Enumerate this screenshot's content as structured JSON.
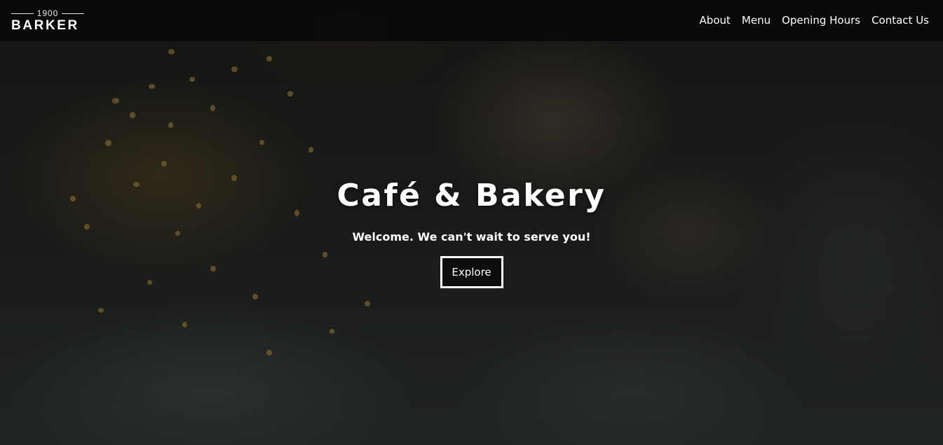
{
  "brand": {
    "year": "1900",
    "name": "BARKER"
  },
  "nav": {
    "items": [
      {
        "label": "About"
      },
      {
        "label": "Menu"
      },
      {
        "label": "Opening Hours"
      },
      {
        "label": "Contact Us"
      }
    ]
  },
  "hero": {
    "title": "Café & Bakery",
    "subtitle": "Welcome. We can't wait to serve you!",
    "button_label": "Explore"
  }
}
